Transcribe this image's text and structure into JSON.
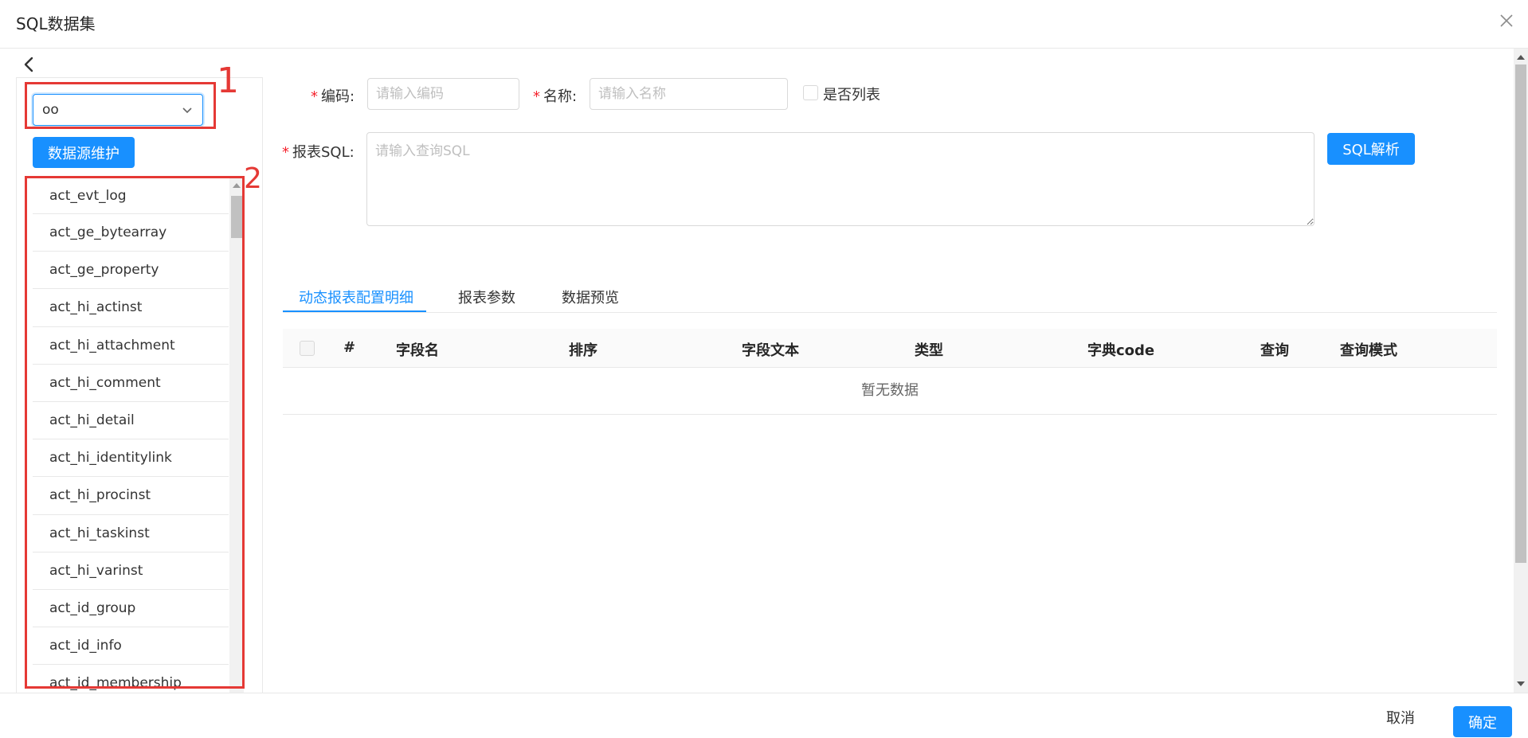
{
  "dialog": {
    "title": "SQL数据集",
    "close_icon": "close-icon",
    "back_icon": "chevron-left-icon"
  },
  "datasource": {
    "selected": "oo",
    "maintain_label": "数据源维护"
  },
  "tables": [
    "act_evt_log",
    "act_ge_bytearray",
    "act_ge_property",
    "act_hi_actinst",
    "act_hi_attachment",
    "act_hi_comment",
    "act_hi_detail",
    "act_hi_identitylink",
    "act_hi_procinst",
    "act_hi_taskinst",
    "act_hi_varinst",
    "act_id_group",
    "act_id_info",
    "act_id_membership"
  ],
  "annotations": {
    "one": "1",
    "two": "2"
  },
  "form": {
    "required_mark": "*",
    "code_label": "编码:",
    "code_placeholder": "请输入编码",
    "name_label": "名称:",
    "name_placeholder": "请输入名称",
    "is_list_label": "是否列表",
    "sql_label": "报表SQL:",
    "sql_placeholder": "请输入查询SQL",
    "parse_label": "SQL解析"
  },
  "tabs": [
    {
      "label": "动态报表配置明细",
      "active": true
    },
    {
      "label": "报表参数",
      "active": false
    },
    {
      "label": "数据预览",
      "active": false
    }
  ],
  "grid": {
    "columns": [
      "#",
      "字段名",
      "排序",
      "字段文本",
      "类型",
      "字典code",
      "查询",
      "查询模式"
    ],
    "empty_text": "暂无数据"
  },
  "footer": {
    "cancel_label": "取消",
    "ok_label": "确定"
  },
  "colors": {
    "primary": "#1890ff",
    "annotation": "#e53935",
    "required": "#f5222d"
  }
}
